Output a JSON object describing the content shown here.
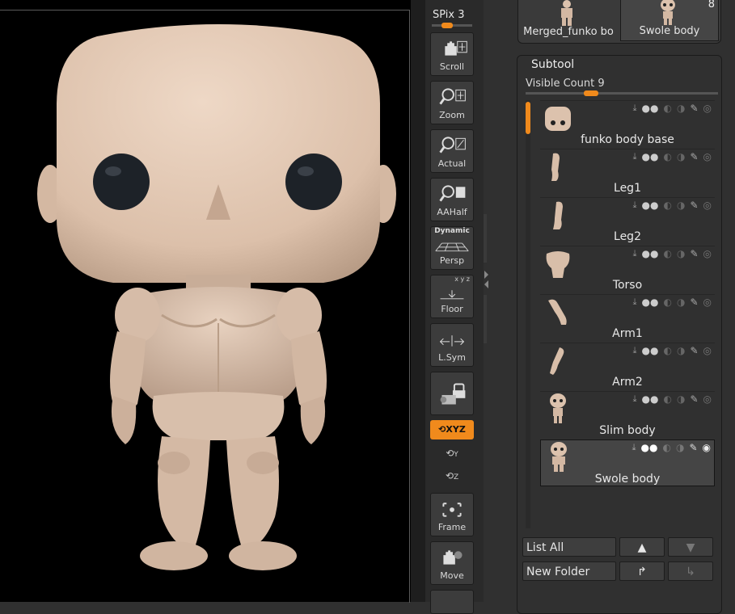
{
  "toolbar": {
    "spix_label": "SPix",
    "spix_value": "3",
    "buttons": [
      {
        "label": "Scroll",
        "icon": "hand-icon"
      },
      {
        "label": "Zoom",
        "icon": "magnifier-plus-icon"
      },
      {
        "label": "Actual",
        "icon": "magnifier-actual-icon"
      },
      {
        "label": "AAHalf",
        "icon": "magnifier-half-icon"
      },
      {
        "label": "Persp",
        "icon": "perspective-grid-icon",
        "top_text": "Dynamic"
      },
      {
        "label": "Floor",
        "icon": "floor-icon",
        "top_text": "x y z"
      },
      {
        "label": "L.Sym",
        "icon": "local-symmetry-icon"
      },
      {
        "label": "",
        "icon": "lock-camera-icon"
      },
      {
        "label": "Frame",
        "icon": "frame-icon"
      },
      {
        "label": "Move",
        "icon": "move-hand-icon"
      }
    ],
    "xyz_label": "XYZ",
    "rotate_y_label": "Y",
    "rotate_z_label": "Z"
  },
  "tool_thumbs": [
    {
      "label": "Merged_funko bo"
    },
    {
      "label": "Swole body",
      "badge": "8"
    }
  ],
  "subtool": {
    "title": "Subtool",
    "visible_count_label": "Visible Count",
    "visible_count_value": "9",
    "items": [
      {
        "name": "funko body base",
        "thumb": "head-block"
      },
      {
        "name": "Leg1",
        "thumb": "leg"
      },
      {
        "name": "Leg2",
        "thumb": "leg"
      },
      {
        "name": "Torso",
        "thumb": "torso"
      },
      {
        "name": "Arm1",
        "thumb": "arm"
      },
      {
        "name": "Arm2",
        "thumb": "arm"
      },
      {
        "name": "Slim body",
        "thumb": "figure"
      },
      {
        "name": "Swole body",
        "thumb": "figure",
        "selected": true
      }
    ]
  },
  "bottom_buttons": {
    "list_all": "List All",
    "new_folder": "New Folder"
  },
  "colors": {
    "accent": "#f08a1c",
    "skin": "#dcc2ad",
    "panel_bg": "#303030",
    "viewport_bg": "#000000"
  }
}
